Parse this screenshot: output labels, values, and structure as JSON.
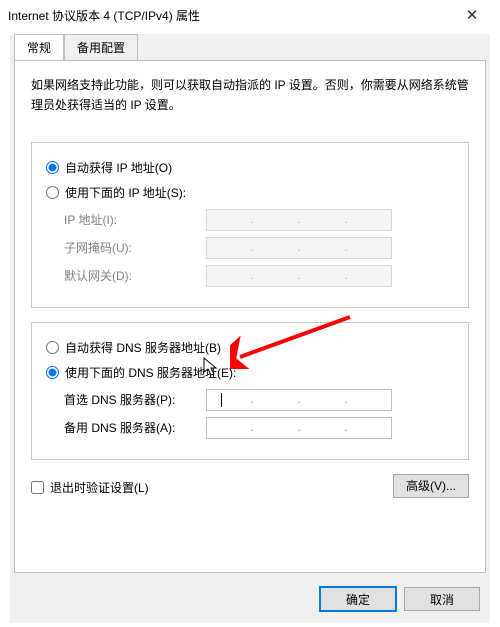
{
  "window": {
    "title": "Internet 协议版本 4 (TCP/IPv4) 属性",
    "close": "✕"
  },
  "tabs": {
    "general": "常规",
    "alternate": "备用配置"
  },
  "description": "如果网络支持此功能，则可以获取自动指派的 IP 设置。否则，你需要从网络系统管理员处获得适当的 IP 设置。",
  "ip_group": {
    "auto_label": "自动获得 IP 地址(O)",
    "manual_label": "使用下面的 IP 地址(S):",
    "ip_label": "IP 地址(I):",
    "mask_label": "子网掩码(U):",
    "gw_label": "默认网关(D):"
  },
  "dns_group": {
    "auto_label": "自动获得 DNS 服务器地址(B)",
    "manual_label": "使用下面的 DNS 服务器地址(E):",
    "pref_label": "首选 DNS 服务器(P):",
    "alt_label": "备用 DNS 服务器(A):"
  },
  "validate_label": "退出时验证设置(L)",
  "advanced_btn": "高级(V)...",
  "ok_btn": "确定",
  "cancel_btn": "取消"
}
